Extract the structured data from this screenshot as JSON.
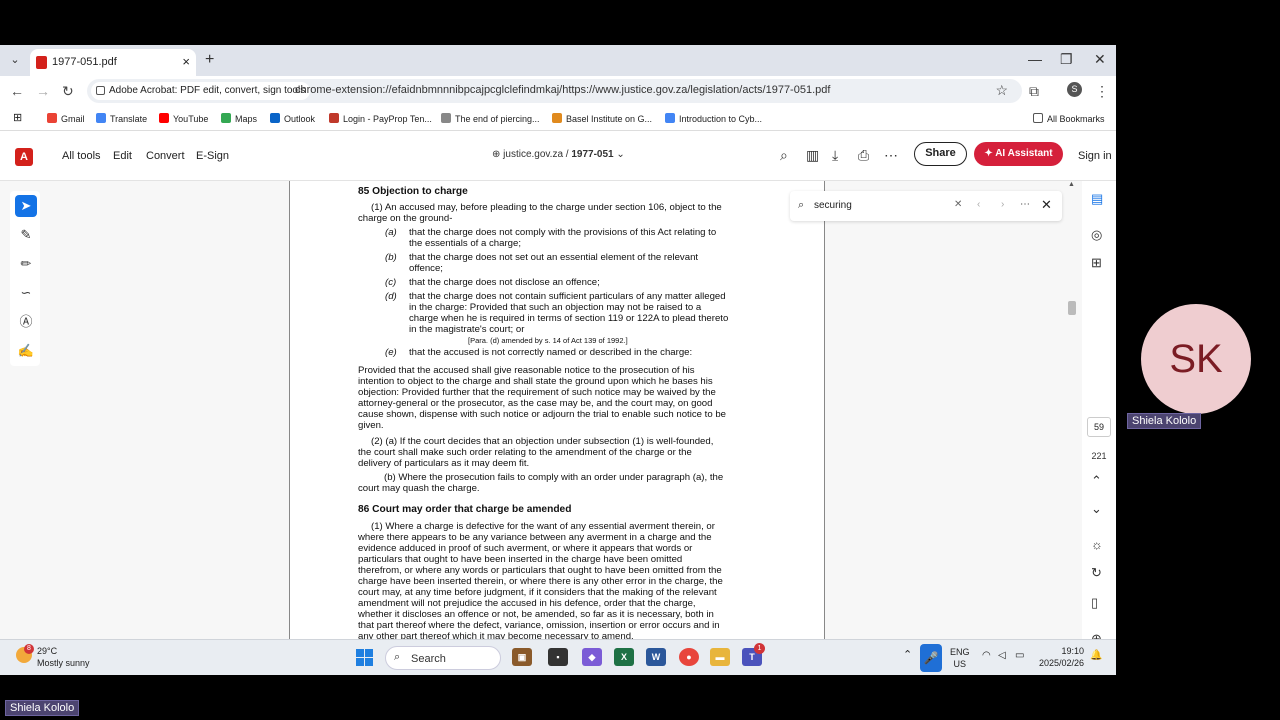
{
  "browser": {
    "tab_title": "1977-051.pdf",
    "new_tab": "+",
    "window_controls": [
      "—",
      "❐",
      "✕"
    ],
    "extension_chip": "Adobe Acrobat: PDF edit, convert, sign tools",
    "url": "chrome-extension://efaidnbmnnnibpcajpcglclefindmkaj/https://www.justice.gov.za/legislation/acts/1977-051.pdf",
    "profile_initial": "S",
    "bookmarks": [
      "Gmail",
      "Translate",
      "YouTube",
      "Maps",
      "Outlook",
      "Login - PayProp Ten...",
      "The end of piercing...",
      "Basel Institute on G...",
      "Introduction to Cyb..."
    ],
    "all_bookmarks": "All Bookmarks"
  },
  "acrobat": {
    "logo": "A",
    "menu": [
      "All tools",
      "Edit",
      "Convert",
      "E-Sign"
    ],
    "breadcrumb_site": "justice.gov.za",
    "breadcrumb_sep": "/",
    "breadcrumb_doc": "1977-051",
    "share": "Share",
    "ai_assistant": "AI Assistant",
    "sign_in": "Sign in",
    "page_current": "59",
    "page_total": "221"
  },
  "find": {
    "query": "securing"
  },
  "document": {
    "s85_heading": "85  Objection to charge",
    "s85_intro_1": "(1) An accused may, before pleading to the charge under section 106, object to the",
    "s85_intro_2": "charge on the ground-",
    "a_label": "(a)",
    "a_1": "that the charge does not comply with the provisions of this Act relating to",
    "a_2": "the essentials of a charge;",
    "b_label": "(b)",
    "b_1": "that the charge does not set out an essential element of the relevant",
    "b_2": "offence;",
    "c_label": "(c)",
    "c_1": "that the charge does not disclose an offence;",
    "d_label": "(d)",
    "d_1": "that the charge does not contain sufficient particulars of any matter alleged",
    "d_2": "in the charge: Provided that such an objection may not be raised to a",
    "d_3": "charge when he is required in terms of section 119 or 122A to plead thereto",
    "d_4": "in the magistrate's court; or",
    "d_note": "[Para. (d) amended by s. 14 of Act 139 of 1992.]",
    "e_label": "(e)",
    "e_1": "that the accused is not correctly named or described in the charge:",
    "prov_1": "Provided that the accused shall give reasonable notice to the prosecution of his",
    "prov_2": "intention to object to the charge and shall state the ground upon which he bases his",
    "prov_3": "objection: Provided further that the requirement of such notice may be waived by the",
    "prov_4": "attorney-general or the prosecutor, as the case may be, and the court may, on good",
    "prov_5": "cause shown, dispense with such notice or adjourn the trial to enable such notice to be",
    "prov_6": "given.",
    "s2a_1": "(2) (a) If the court decides that an objection under subsection (1) is well-founded,",
    "s2a_2": "the court shall make such order relating to the amendment of the charge or the",
    "s2a_3": "delivery of particulars as it may deem fit.",
    "s2b_1": "(b) Where the prosecution fails to comply with an order under paragraph (a), the",
    "s2b_2": "court may quash the charge.",
    "s86_heading": "86  Court may order that charge be amended",
    "s86_1": "(1) Where a charge is defective for the want of any essential averment therein, or",
    "s86_2": "where there appears to be any variance between any averment in a charge and the",
    "s86_3": "evidence adduced in proof of such averment, or where it appears that words or",
    "s86_4": "particulars that ought to have been inserted in the charge have been omitted",
    "s86_5": "therefrom, or where any words or particulars that ought to have been omitted from the",
    "s86_6": "charge have been inserted therein, or where there is any other error in the charge, the",
    "s86_7": "court may, at any time before judgment, if it considers that the making of the relevant",
    "s86_8": "amendment will not prejudice the accused in his defence, order that the charge,",
    "s86_9": "whether it discloses an offence or not, be amended, so far as it is necessary, both in",
    "s86_10": "that part thereof where the defect, variance, omission, insertion or error occurs and in",
    "s86_11": "any other part thereof which it may become necessary to amend."
  },
  "taskbar": {
    "temp": "29°C",
    "weather": "Mostly sunny",
    "weather_badge": "8",
    "search": "Search",
    "lang_1": "ENG",
    "lang_2": "US",
    "time": "19:10",
    "date": "2025/02/26",
    "notif_badge": "1"
  },
  "meeting": {
    "avatar_initials": "SK",
    "participant_name": "Shiela Kololo",
    "self_name": "Shiela Kololo"
  }
}
